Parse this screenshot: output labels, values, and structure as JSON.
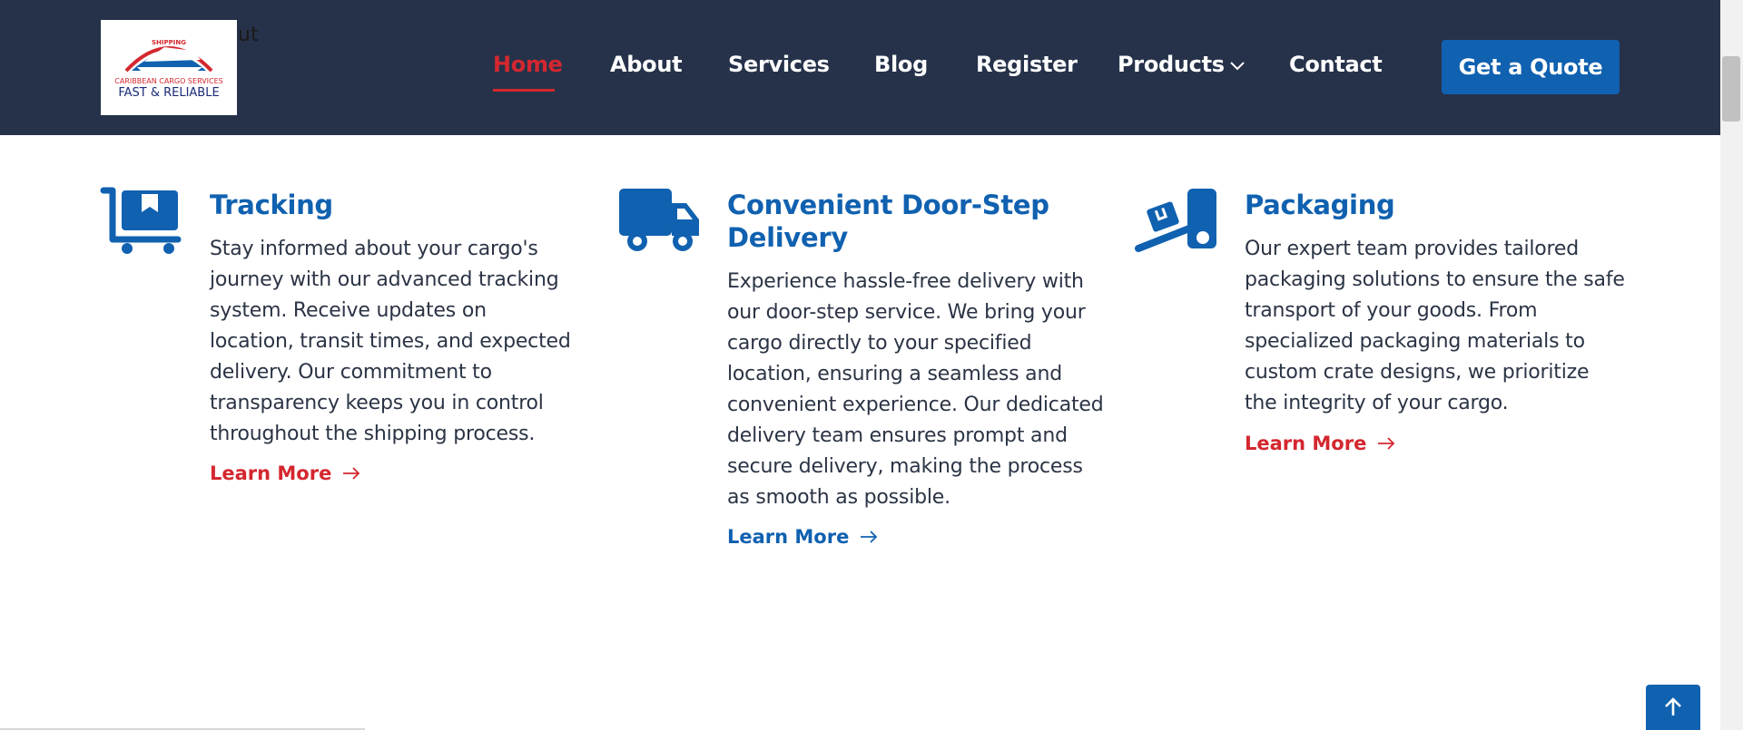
{
  "header": {
    "logo": {
      "top_text": "SHIPPING",
      "company_line": "CARIBBEAN CARGO SERVICES",
      "tagline": "FAST & RELIABLE",
      "overflow_text": "ut"
    },
    "nav": [
      {
        "label": "Home",
        "active": true
      },
      {
        "label": "About",
        "active": false
      },
      {
        "label": "Services",
        "active": false
      },
      {
        "label": "Blog",
        "active": false
      },
      {
        "label": "Register",
        "active": false
      },
      {
        "label": "Products",
        "active": false,
        "dropdown": true
      },
      {
        "label": "Contact",
        "active": false
      }
    ],
    "cta_label": "Get a Quote"
  },
  "features": [
    {
      "icon": "cart-box-icon",
      "title": "Tracking",
      "description": "Stay informed about your cargo's journey with our advanced tracking system. Receive updates on location, transit times, and expected delivery. Our commitment to transparency keeps you in control throughout the shipping process.",
      "link": "Learn More"
    },
    {
      "icon": "truck-icon",
      "title": "Convenient Door-Step Delivery",
      "description": "Experience hassle-free delivery with our door-step service. We bring your cargo directly to your specified location, ensuring a seamless and convenient experience. Our dedicated delivery team ensures prompt and secure delivery, making the process as smooth as possible.",
      "link": "Learn More"
    },
    {
      "icon": "dolly-icon",
      "title": "Packaging",
      "description": "Our expert team provides tailored packaging solutions to ensure the safe transport of your goods. From specialized packaging materials to custom crate designs, we prioritize the integrity of your cargo.",
      "link": "Learn More"
    }
  ],
  "colors": {
    "header_bg": "#26324a",
    "accent_red": "#d4272f",
    "brand_blue": "#1061b0"
  }
}
